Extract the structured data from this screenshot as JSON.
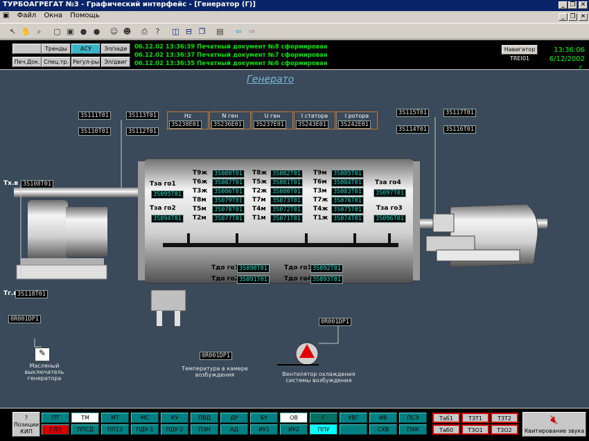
{
  "window": {
    "title": "ТУРБОАГРЕГАТ №3 - Графический интерфейс - [Генератор (Г)]",
    "min": "_",
    "restore": "❐",
    "close": "✕",
    "doc_close": "✕"
  },
  "menu": [
    "Файл",
    "Окна",
    "Помощь"
  ],
  "panel": {
    "buttons": [
      {
        "label": "",
        "on": false
      },
      {
        "label": "Тренды",
        "on": false
      },
      {
        "label": "АСУ",
        "on": true
      },
      {
        "label": "Эл/заде",
        "on": false
      },
      {
        "label": "Печ.Док.",
        "on": false
      },
      {
        "label": "Спец.тр.",
        "on": false
      },
      {
        "label": "Регул-ры",
        "on": false
      },
      {
        "label": "Эл/двиг",
        "on": false
      }
    ],
    "events": [
      "06.12.02 13:36:39  Печатный документ №8 сформирован",
      "06.12.02 13:36:37  Печатный документ №7 сформирован",
      "06.12.02 13:36:35  Печатный документ №6 сформирован"
    ],
    "navigator": "Навигатор",
    "station": "TREI01",
    "time": "13:36:06",
    "date": "6/12/2002 г."
  },
  "page_title": "Генерато",
  "params": [
    {
      "label": "Hz",
      "tag": "3S238E01"
    },
    {
      "label": "N ген",
      "tag": "3S236E01"
    },
    {
      "label": "U ген",
      "tag": "3S237E01"
    },
    {
      "label": "I статора",
      "tag": "3S243E01"
    },
    {
      "label": "I ротора",
      "tag": "3S242E01"
    }
  ],
  "left_tags": [
    "3S111T01",
    "3S113T01",
    "3S110T01",
    "3S112T01"
  ],
  "right_tags": [
    "3S115T01",
    "3S117T01",
    "3S114T01",
    "3S116T01"
  ],
  "misc_tags": {
    "txv": "3S108T01",
    "tgv": "3S118T01",
    "oil": "0R001DP1",
    "temp": "0R001DP1",
    "fan": "0R001DP1"
  },
  "tx_labels": {
    "txv": "Tх.в",
    "tgv": "Tг.в"
  },
  "stator": [
    {
      "l1": "T9ж",
      "t1": "3S088T01",
      "l2": "T8ж",
      "t2": "3S082T01",
      "l3": "T9м",
      "t3": "3S085T01"
    },
    {
      "l1": "T6ж",
      "t1": "3S087T01",
      "l2": "T5ж",
      "t2": "3S081T01",
      "l3": "T6м",
      "t3": "3S084T01"
    },
    {
      "l1": "T3ж",
      "t1": "3S086T01",
      "l2": "T2ж",
      "t2": "3S080T01",
      "l3": "T3м",
      "t3": "3S083T01"
    },
    {
      "l1": "T8м",
      "t1": "3S079T01",
      "l2": "T7м",
      "t2": "3S073T01",
      "l3": "T7ж",
      "t3": "3S076T01"
    },
    {
      "l1": "T5м",
      "t1": "3S078T01",
      "l2": "T4м",
      "t2": "3S072T01",
      "l3": "T4ж",
      "t3": "3S075T01"
    },
    {
      "l1": "T2м",
      "t1": "3S077T01",
      "l2": "T1м",
      "t2": "3S071T01",
      "l3": "T1ж",
      "t3": "3S074T01"
    }
  ],
  "gas": [
    {
      "l": "Tза го1",
      "t": "3S095T01"
    },
    {
      "l": "Tза го2",
      "t": "3S094T01"
    },
    {
      "l": "Tза го4",
      "t": "3S097T01"
    },
    {
      "l": "Tза го3",
      "t": "3S096T01"
    }
  ],
  "gas_before": [
    {
      "l": "Tдо го1",
      "t": "3S090T01"
    },
    {
      "l": "Tдо го3",
      "t": "3S092T01"
    },
    {
      "l": "Tдо го2",
      "t": "3S091T01"
    },
    {
      "l": "Tдо го4",
      "t": "3S093T01"
    }
  ],
  "captions": {
    "oil": "Масляный выключатель генератора",
    "temp": "Температура в камере возбуждения",
    "fan": "Вентилятор охлаждения системы возбуждения"
  },
  "bottom": {
    "pos_label": "? Позиции КИП",
    "row1": [
      "ПТ",
      "ТМ",
      "МТ",
      "МС",
      "КУ",
      "ПВД",
      "ДР",
      "БУ",
      "ОВ",
      "Г",
      "УВГ",
      "ИВ",
      "ПСЭ"
    ],
    "row2": [
      "ГЛП",
      "ППСД",
      "ПП13",
      "ПДУ-1",
      "ПДУ-2",
      "ПЭН",
      "АД",
      "ИУ1",
      "ИУ2",
      "ППУ",
      "",
      "СХВ",
      "ПХК"
    ],
    "right1": [
      "Таб1",
      "ТЗТ1",
      "ТЗТ2"
    ],
    "right2": [
      "Таб0",
      "ТЗО1",
      "ТЗО2"
    ],
    "kvit": "Квитирование звука"
  },
  "colors": {
    "bg": "#3a4a5a",
    "cyan": "#00e0d0",
    "teal": "#008080",
    "alarm": "#d00000"
  }
}
